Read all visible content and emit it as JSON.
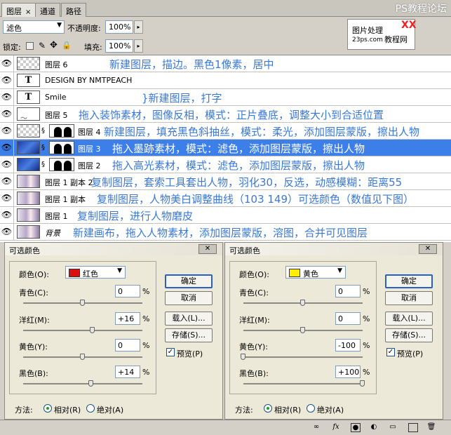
{
  "tabs": [
    "图层",
    "通道",
    "路径"
  ],
  "tab_close": "×",
  "watermark": "PS教程论坛",
  "options": {
    "blend_mode": "滤色",
    "opacity_label": "不透明度:",
    "opacity_value": "100%",
    "lock_label": "锁定:",
    "fill_label": "填充:",
    "fill_value": "100%"
  },
  "logo": {
    "line1": "图片处理",
    "line2": "23ps.com",
    "line3": "教程网",
    "line4": "XX"
  },
  "layers": [
    {
      "name": "图层 6",
      "note": "新建图层，描边。黑色1像素，居中",
      "thumb": "checker",
      "selected": false
    },
    {
      "name": "DESIGN BY NMTPEACH",
      "note": "",
      "thumb": "T",
      "selected": false
    },
    {
      "name": "Smile",
      "note": "}新建图层，打字",
      "thumb": "T",
      "selected": false
    },
    {
      "name": "图层 5",
      "note": "拖入装饰素材，图像反相，模式：正片叠底，调整大小到合适位置",
      "thumb": "swirl",
      "selected": false
    },
    {
      "name": "图层 4",
      "note": "新建图层，填充黑色斜抽丝，模式：柔光，添加图层蒙版，擦出人物",
      "thumb": "checker",
      "selected": false
    },
    {
      "name": "图层 3",
      "note": "拖入墨跡素材，模式：滤色，添加图层蒙版，擦出人物",
      "thumb": "blue",
      "selected": true
    },
    {
      "name": "图层 2",
      "note": "拖入高光素材，模式：滤色，添加图层蒙版，擦出人物",
      "thumb": "blue",
      "selected": false
    },
    {
      "name": "图层 1 副本 2",
      "note": "复制图层，套索工具套出人物，羽化30，反选，动感模糊：距离55",
      "thumb": "photo",
      "selected": false
    },
    {
      "name": "图层 1 副本",
      "note": "复制图层，人物美白调整曲线（103 149）可选颜色（数值见下图）",
      "thumb": "photo",
      "selected": false
    },
    {
      "name": "图层 1",
      "note": "复制图层，进行人物磨皮",
      "thumb": "photo",
      "selected": false
    },
    {
      "name": "背景",
      "note": "新建画布，拖入人物素材，添加图层蒙版，溶图，合并可见图层",
      "thumb": "photo",
      "selected": false
    }
  ],
  "dialogs": [
    {
      "title": "可选颜色",
      "color_label": "颜色(O):",
      "color_name": "红色",
      "swatch": "#d81010",
      "fields": [
        {
          "label": "青色(C):",
          "value": "0",
          "level": 0
        },
        {
          "label": "洋红(M):",
          "value": "+16",
          "level": 16
        },
        {
          "label": "黄色(Y):",
          "value": "0",
          "level": 0
        },
        {
          "label": "黑色(B):",
          "value": "+14",
          "level": 14
        }
      ],
      "buttons": [
        "确定",
        "取消",
        "载入(L)...",
        "存储(S)..."
      ],
      "preview_label": "预览(P)",
      "method_label": "方法:",
      "method_relative": "相对(R)",
      "method_absolute": "绝对(A)",
      "method_selected": "relative"
    },
    {
      "title": "可选颜色",
      "color_label": "颜色(O):",
      "color_name": "黄色",
      "swatch": "#ffee00",
      "fields": [
        {
          "label": "青色(C):",
          "value": "0",
          "level": 0
        },
        {
          "label": "洋红(M):",
          "value": "0",
          "level": 0
        },
        {
          "label": "黄色(Y):",
          "value": "-100",
          "level": -100
        },
        {
          "label": "黑色(B):",
          "value": "+100",
          "level": 100
        }
      ],
      "buttons": [
        "确定",
        "取消",
        "载入(L)...",
        "存储(S)..."
      ],
      "preview_label": "预览(P)",
      "method_label": "方法:",
      "method_relative": "相对(R)",
      "method_absolute": "绝对(A)",
      "method_selected": "relative"
    }
  ],
  "percent_sign": "%",
  "status_icons": [
    "link-icon",
    "fx-icon",
    "mask-icon",
    "adjustment-icon",
    "folder-icon",
    "new-layer-icon",
    "trash-icon"
  ],
  "colors": {
    "selection": "#3d7fe8",
    "note": "#3a78d4"
  }
}
